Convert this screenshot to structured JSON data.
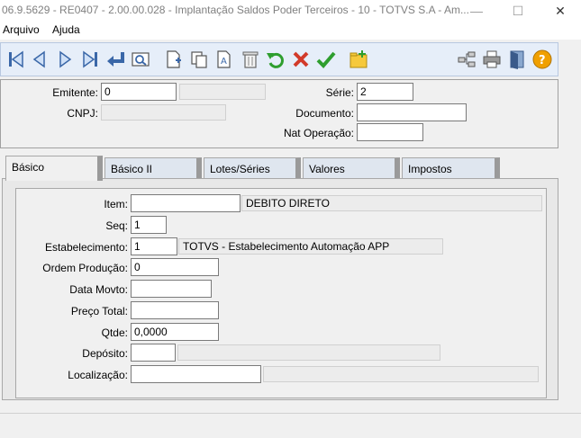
{
  "window": {
    "title": "06.9.5629 - RE0407 - 2.00.00.028 - Implantação Saldos Poder Terceiros - 10 - TOTVS S.A - Am...",
    "minimize": "—",
    "maximize": "☐",
    "close": "✕"
  },
  "menu": {
    "items": [
      "Arquivo",
      "Ajuda"
    ]
  },
  "toolbar": {
    "icons": [
      "first-record",
      "previous-record",
      "next-record",
      "last-record",
      "goto-record",
      "search",
      "new-record",
      "copy-record",
      "edit-record",
      "delete-record",
      "undo",
      "cancel",
      "confirm",
      "new-folder",
      "flow",
      "print",
      "exit",
      "help"
    ]
  },
  "header": {
    "emitente_label": "Emitente:",
    "emitente_value": "0",
    "emitente_desc": "",
    "cnpj_label": "CNPJ:",
    "cnpj_value": "",
    "serie_label": "Série:",
    "serie_value": "2",
    "documento_label": "Documento:",
    "documento_value": "",
    "natop_label": "Nat Operação:",
    "natop_value": ""
  },
  "tabs": [
    "Básico",
    "Básico II",
    "Lotes/Séries",
    "Valores",
    "Impostos"
  ],
  "form": {
    "item_label": "Item:",
    "item_value": "",
    "item_desc": "DEBITO DIRETO",
    "seq_label": "Seq:",
    "seq_value": "1",
    "estab_label": "Estabelecimento:",
    "estab_value": "1",
    "estab_desc": "TOTVS - Estabelecimento Automação APP",
    "ordem_label": "Ordem Produção:",
    "ordem_value": "0",
    "data_label": "Data Movto:",
    "data_value": "",
    "preco_label": "Preço Total:",
    "preco_value": "",
    "qtde_label": "Qtde:",
    "qtde_value": "0,0000",
    "deposito_label": "Depósito:",
    "deposito_value": "",
    "deposito_desc": "",
    "local_label": "Localização:",
    "local_value": "",
    "local_desc": ""
  },
  "colors": {
    "toolbar_bg": "#e6eef9",
    "tab_bg": "#dfe6ef",
    "accent_green": "#2e9e2e",
    "accent_red": "#d23a2a",
    "help_orange": "#f0a000"
  }
}
